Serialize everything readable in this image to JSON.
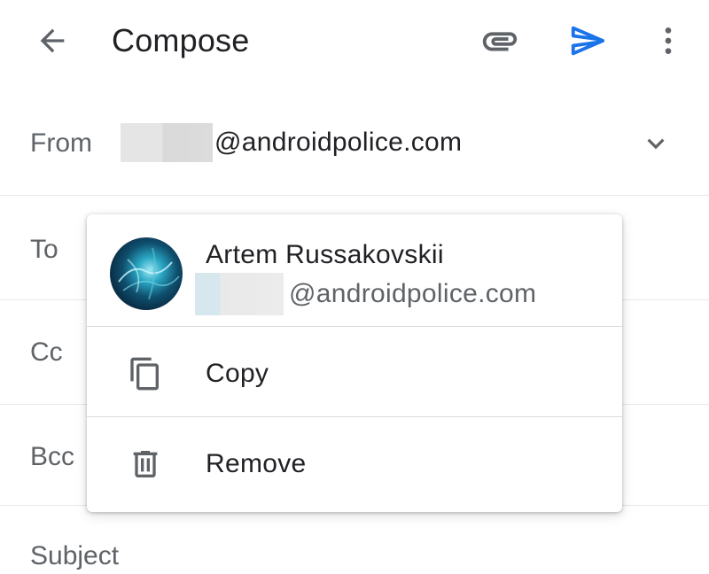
{
  "app_bar": {
    "title": "Compose",
    "back_icon": "arrow-back-icon",
    "attach_icon": "paperclip-icon",
    "send_icon": "send-icon",
    "more_icon": "more-vert-icon"
  },
  "form": {
    "from_label": "From",
    "from_value": "@androidpolice.com",
    "to_label": "To",
    "cc_label": "Cc",
    "bcc_label": "Bcc",
    "subject_label": "Subject"
  },
  "contact_popup": {
    "name": "Artem Russakovskii",
    "email": "@androidpolice.com",
    "items": [
      {
        "label": "Copy",
        "icon": "copy-icon"
      },
      {
        "label": "Remove",
        "icon": "trash-icon"
      }
    ]
  },
  "colors": {
    "accent": "#1a73e8",
    "icon_gray": "#5f6368",
    "text": "#202124"
  }
}
